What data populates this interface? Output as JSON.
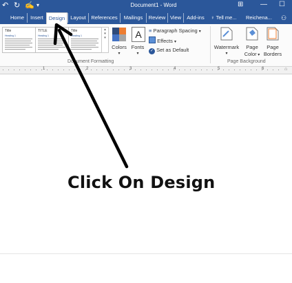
{
  "window": {
    "title": "Document1 - Word",
    "quick_access": {
      "undo": "↶",
      "redo": "↻",
      "touch": "✍",
      "customize": "▾"
    },
    "controls": {
      "ribbon_options": "⊞",
      "minimize": "—",
      "restore": "☐"
    }
  },
  "tabs": [
    {
      "label": "Home"
    },
    {
      "label": "Insert"
    },
    {
      "label": "Design"
    },
    {
      "label": "Layout"
    },
    {
      "label": "References"
    },
    {
      "label": "Mailings"
    },
    {
      "label": "Review"
    },
    {
      "label": "View"
    },
    {
      "label": "Add-ins"
    }
  ],
  "tell_me": "Tell me...",
  "account": "Reichena...",
  "ribbon": {
    "style_gallery": [
      {
        "title": "Title",
        "heading": "Heading 1"
      },
      {
        "title": "TITLE",
        "heading": "Heading 1"
      },
      {
        "title": "Title",
        "heading": "Heading 1"
      }
    ],
    "colors_label": "Colors",
    "fonts_label": "Fonts",
    "fonts_glyph": "A",
    "paragraph_spacing": "Paragraph Spacing",
    "effects": "Effects",
    "set_as_default": "Set as Default",
    "document_formatting": "Document Formatting",
    "watermark": "Watermark",
    "page_color": [
      "Page",
      "Color"
    ],
    "page_borders": [
      "Page",
      "Borders"
    ],
    "page_background": "Page Background"
  },
  "ruler_numbers": [
    "1",
    "2",
    "3",
    "4",
    "5",
    "6"
  ],
  "annotation": {
    "caption": "Click On Design",
    "arrow_color": "#000000"
  },
  "colors": {
    "title_bar": "#2b579a",
    "tab_text": "#ffffff",
    "active_tab_text": "#2b579a",
    "ribbon_bg": "#fbfbfb"
  }
}
